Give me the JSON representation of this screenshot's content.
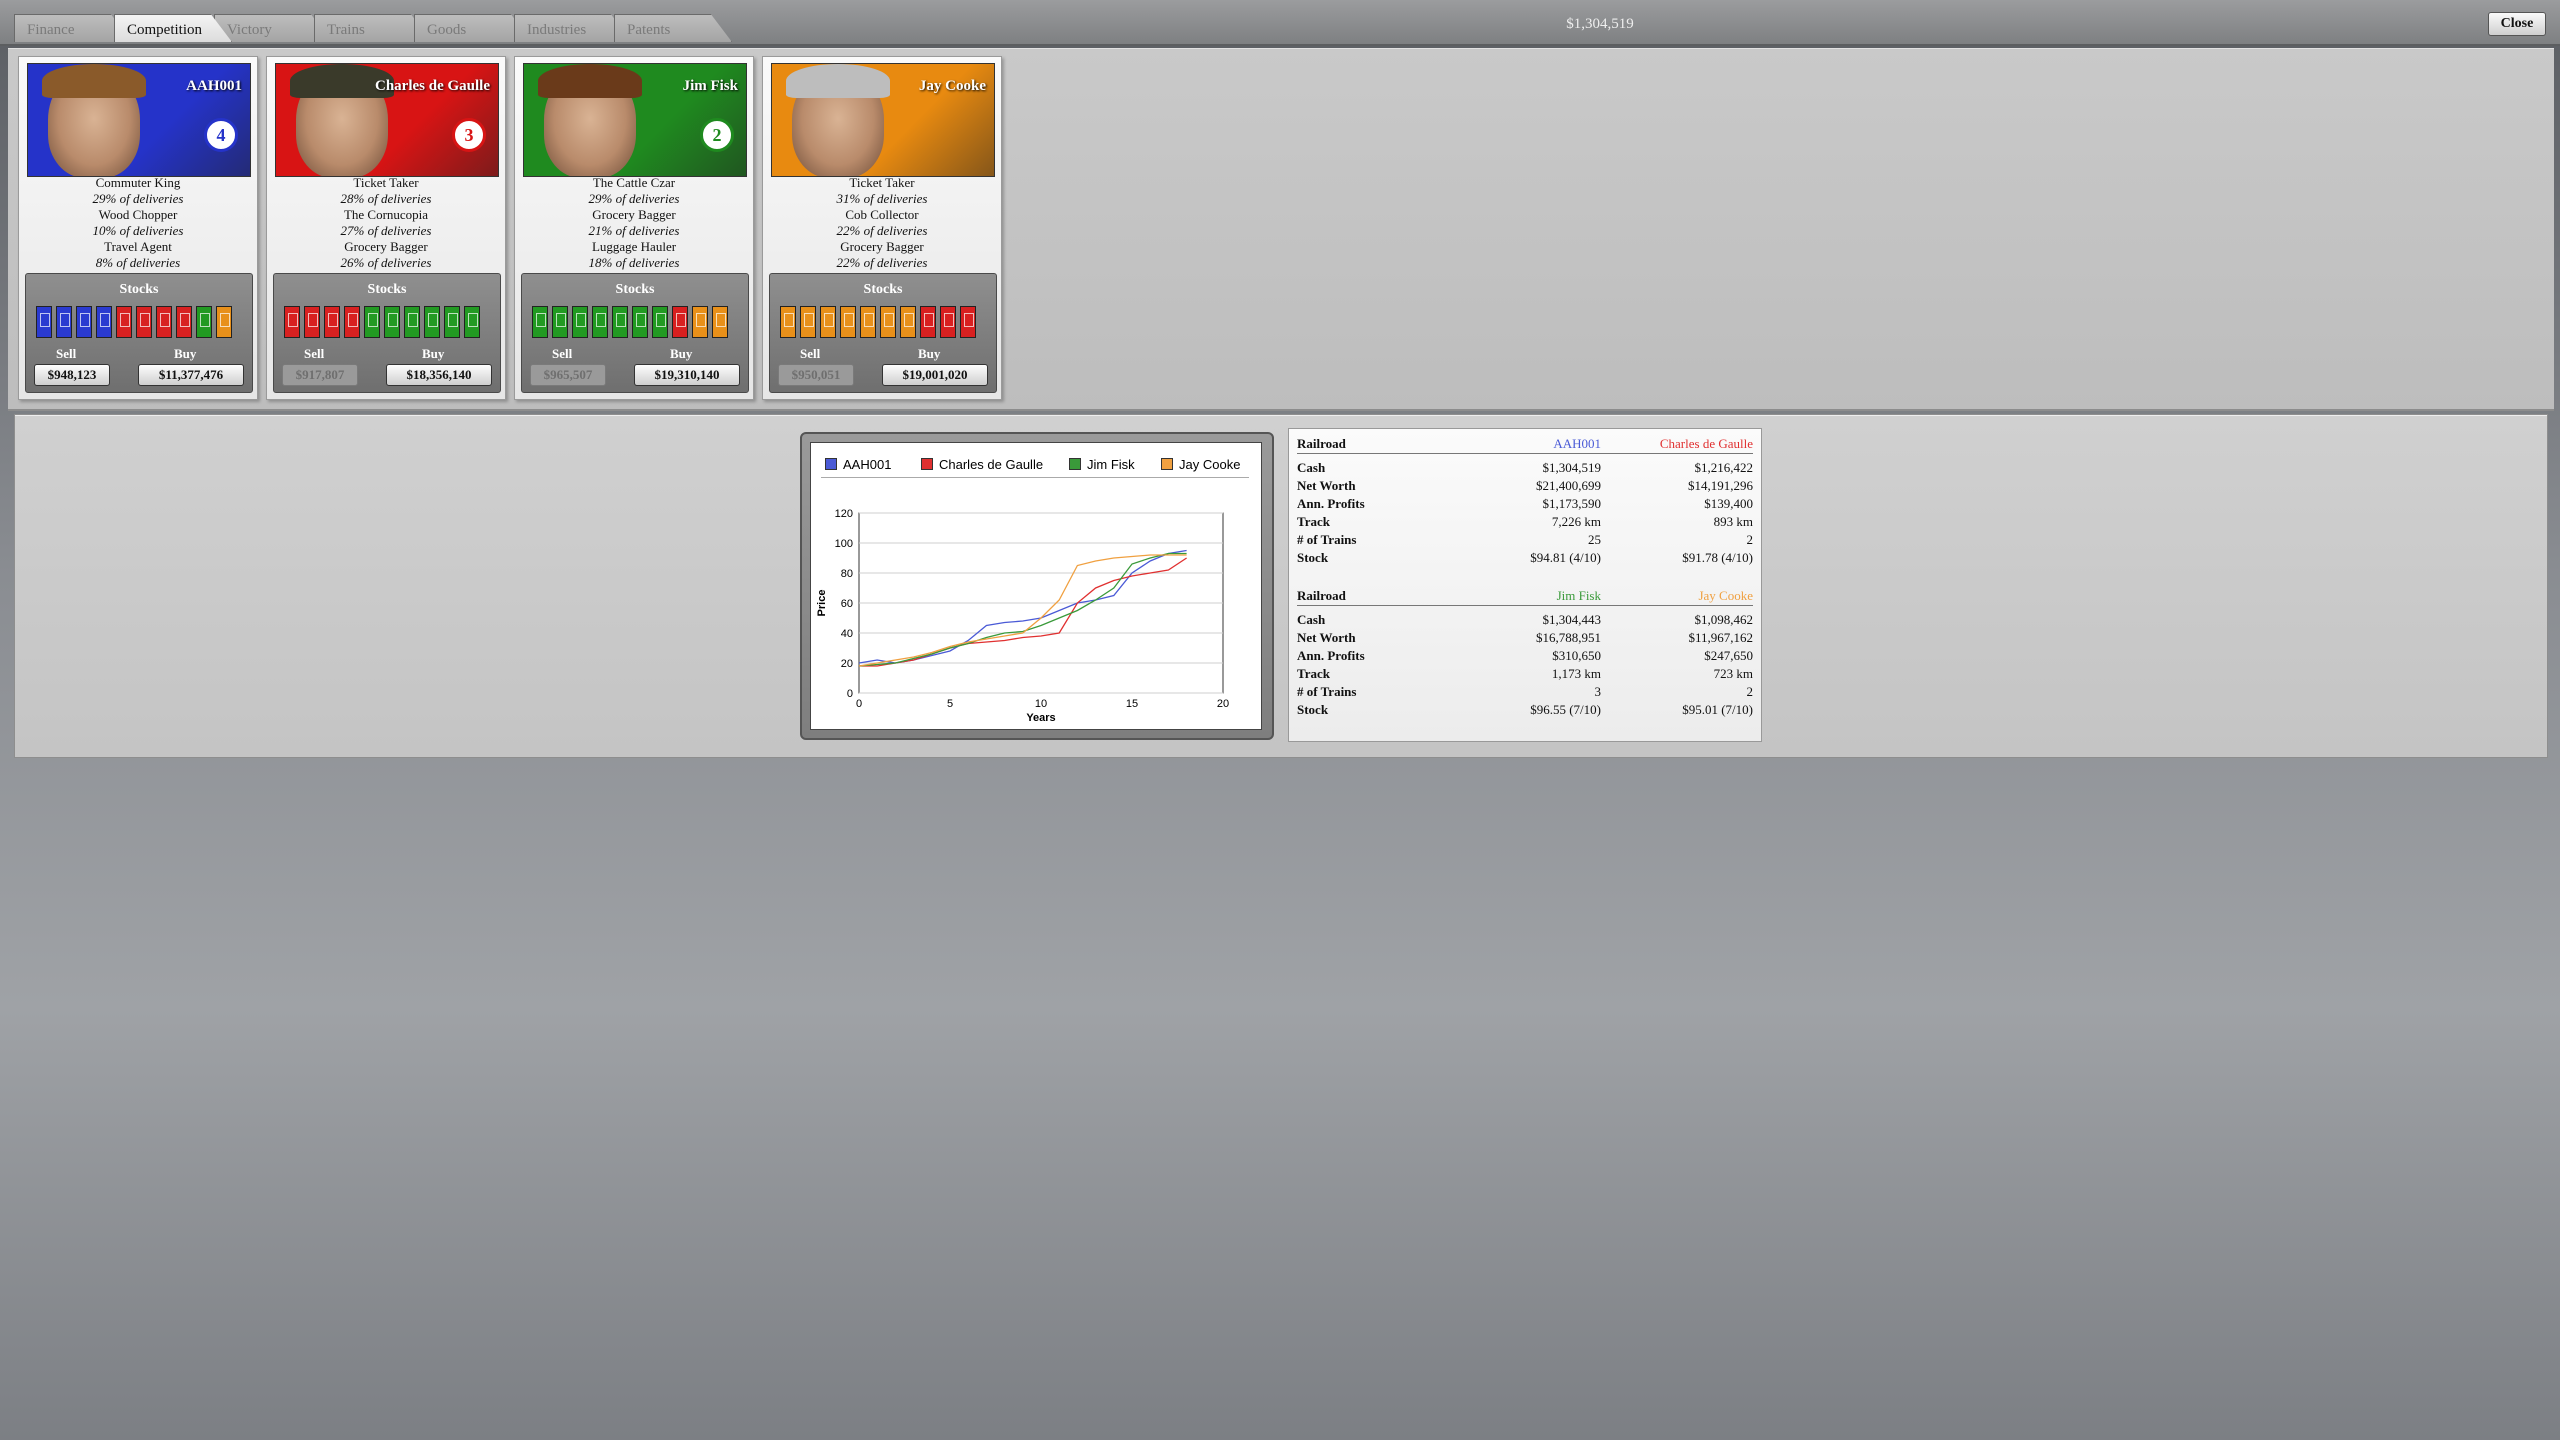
{
  "tabs": [
    "Finance",
    "Competition",
    "Victory",
    "Trains",
    "Goods",
    "Industries",
    "Patents"
  ],
  "active_tab": "Competition",
  "header": {
    "cash": "$1,304,519",
    "close_label": "Close"
  },
  "players": [
    {
      "name": "AAH001",
      "color": "#2533c9",
      "rank": "4",
      "jobs": [
        {
          "title": "Commuter King",
          "pct": "29% of deliveries"
        },
        {
          "title": "Wood Chopper",
          "pct": "10% of deliveries"
        },
        {
          "title": "Travel Agent",
          "pct": "8% of deliveries"
        }
      ],
      "stocks_label": "Stocks",
      "certs": [
        "blue",
        "blue",
        "blue",
        "blue",
        "red",
        "red",
        "red",
        "red",
        "green",
        "orange"
      ],
      "sell_label": "Sell",
      "sell_value": "$948,123",
      "sell_enabled": true,
      "buy_label": "Buy",
      "buy_value": "$11,377,476"
    },
    {
      "name": "Charles de Gaulle",
      "color": "#d81414",
      "rank": "3",
      "jobs": [
        {
          "title": "Ticket Taker",
          "pct": "28% of deliveries"
        },
        {
          "title": "The Cornucopia",
          "pct": "27% of deliveries"
        },
        {
          "title": "Grocery Bagger",
          "pct": "26% of deliveries"
        }
      ],
      "stocks_label": "Stocks",
      "certs": [
        "red",
        "red",
        "red",
        "red",
        "green",
        "green",
        "green",
        "green",
        "green",
        "green"
      ],
      "sell_label": "Sell",
      "sell_value": "$917,807",
      "sell_enabled": false,
      "buy_label": "Buy",
      "buy_value": "$18,356,140"
    },
    {
      "name": "Jim Fisk",
      "color": "#1f8a1f",
      "rank": "2",
      "jobs": [
        {
          "title": "The Cattle Czar",
          "pct": "29% of deliveries"
        },
        {
          "title": "Grocery Bagger",
          "pct": "21% of deliveries"
        },
        {
          "title": "Luggage Hauler",
          "pct": "18% of deliveries"
        }
      ],
      "stocks_label": "Stocks",
      "certs": [
        "green",
        "green",
        "green",
        "green",
        "green",
        "green",
        "green",
        "red",
        "orange",
        "orange"
      ],
      "sell_label": "Sell",
      "sell_value": "$965,507",
      "sell_enabled": false,
      "buy_label": "Buy",
      "buy_value": "$19,310,140"
    },
    {
      "name": "Jay Cooke",
      "color": "#e88a10",
      "rank": "",
      "jobs": [
        {
          "title": "Ticket Taker",
          "pct": "31% of deliveries"
        },
        {
          "title": "Cob Collector",
          "pct": "22% of deliveries"
        },
        {
          "title": "Grocery Bagger",
          "pct": "22% of deliveries"
        }
      ],
      "stocks_label": "Stocks",
      "certs": [
        "orange",
        "orange",
        "orange",
        "orange",
        "orange",
        "orange",
        "orange",
        "red",
        "red",
        "red"
      ],
      "sell_label": "Sell",
      "sell_value": "$950,051",
      "sell_enabled": false,
      "buy_label": "Buy",
      "buy_value": "$19,001,020"
    }
  ],
  "chart_data": {
    "type": "line",
    "xlabel": "Years",
    "ylabel": "Price",
    "xlim": [
      0,
      20
    ],
    "ylim": [
      0,
      120
    ],
    "xticks": [
      0,
      5,
      10,
      15,
      20
    ],
    "yticks": [
      0,
      20,
      40,
      60,
      80,
      100,
      120
    ],
    "grid": true,
    "legend_position": "top",
    "series": [
      {
        "name": "AAH001",
        "color": "#4a5ad6",
        "x": [
          0,
          1,
          2,
          3,
          4,
          5,
          6,
          7,
          8,
          9,
          10,
          11,
          12,
          13,
          14,
          15,
          16,
          17,
          18
        ],
        "y": [
          20,
          22,
          20,
          22,
          25,
          28,
          35,
          45,
          47,
          48,
          50,
          55,
          60,
          62,
          65,
          80,
          88,
          93,
          95
        ]
      },
      {
        "name": "Charles de Gaulle",
        "color": "#e03030",
        "x": [
          0,
          1,
          2,
          3,
          4,
          5,
          6,
          7,
          8,
          9,
          10,
          11,
          12,
          13,
          14,
          15,
          16,
          17,
          18
        ],
        "y": [
          18,
          18,
          20,
          22,
          26,
          30,
          33,
          34,
          35,
          37,
          38,
          40,
          60,
          70,
          75,
          78,
          80,
          82,
          90
        ]
      },
      {
        "name": "Jim Fisk",
        "color": "#3a9a3a",
        "x": [
          0,
          1,
          2,
          3,
          4,
          5,
          6,
          7,
          8,
          9,
          10,
          11,
          12,
          13,
          14,
          15,
          16,
          17,
          18
        ],
        "y": [
          18,
          19,
          20,
          23,
          26,
          30,
          33,
          37,
          40,
          41,
          45,
          50,
          55,
          62,
          70,
          86,
          90,
          93,
          93
        ]
      },
      {
        "name": "Jay Cooke",
        "color": "#f0a040",
        "x": [
          0,
          1,
          2,
          3,
          4,
          5,
          6,
          7,
          8,
          9,
          10,
          11,
          12,
          13,
          14,
          15,
          16,
          17,
          18
        ],
        "y": [
          18,
          20,
          22,
          24,
          27,
          31,
          34,
          36,
          38,
          40,
          50,
          62,
          85,
          88,
          90,
          91,
          92,
          92,
          92
        ]
      }
    ]
  },
  "stats": {
    "groups": [
      {
        "header": "Railroad",
        "names": [
          {
            "text": "AAH001",
            "color": "#4a5ad6"
          },
          {
            "text": "Charles de Gaulle",
            "color": "#e03030"
          }
        ],
        "rows": [
          {
            "label": "Cash",
            "v1": "$1,304,519",
            "v2": "$1,216,422"
          },
          {
            "label": "Net Worth",
            "v1": "$21,400,699",
            "v2": "$14,191,296"
          },
          {
            "label": "Ann. Profits",
            "v1": "$1,173,590",
            "v2": "$139,400"
          },
          {
            "label": "Track",
            "v1": "7,226 km",
            "v2": "893 km"
          },
          {
            "label": "# of Trains",
            "v1": "25",
            "v2": "2"
          },
          {
            "label": "Stock",
            "v1": "$94.81 (4/10)",
            "v2": "$91.78 (4/10)"
          }
        ]
      },
      {
        "header": "Railroad",
        "names": [
          {
            "text": "Jim Fisk",
            "color": "#3a9a3a"
          },
          {
            "text": "Jay Cooke",
            "color": "#f0a040"
          }
        ],
        "rows": [
          {
            "label": "Cash",
            "v1": "$1,304,443",
            "v2": "$1,098,462"
          },
          {
            "label": "Net Worth",
            "v1": "$16,788,951",
            "v2": "$11,967,162"
          },
          {
            "label": "Ann. Profits",
            "v1": "$310,650",
            "v2": "$247,650"
          },
          {
            "label": "Track",
            "v1": "1,173 km",
            "v2": "723 km"
          },
          {
            "label": "# of Trains",
            "v1": "3",
            "v2": "2"
          },
          {
            "label": "Stock",
            "v1": "$96.55 (7/10)",
            "v2": "$95.01 (7/10)"
          }
        ]
      }
    ]
  }
}
